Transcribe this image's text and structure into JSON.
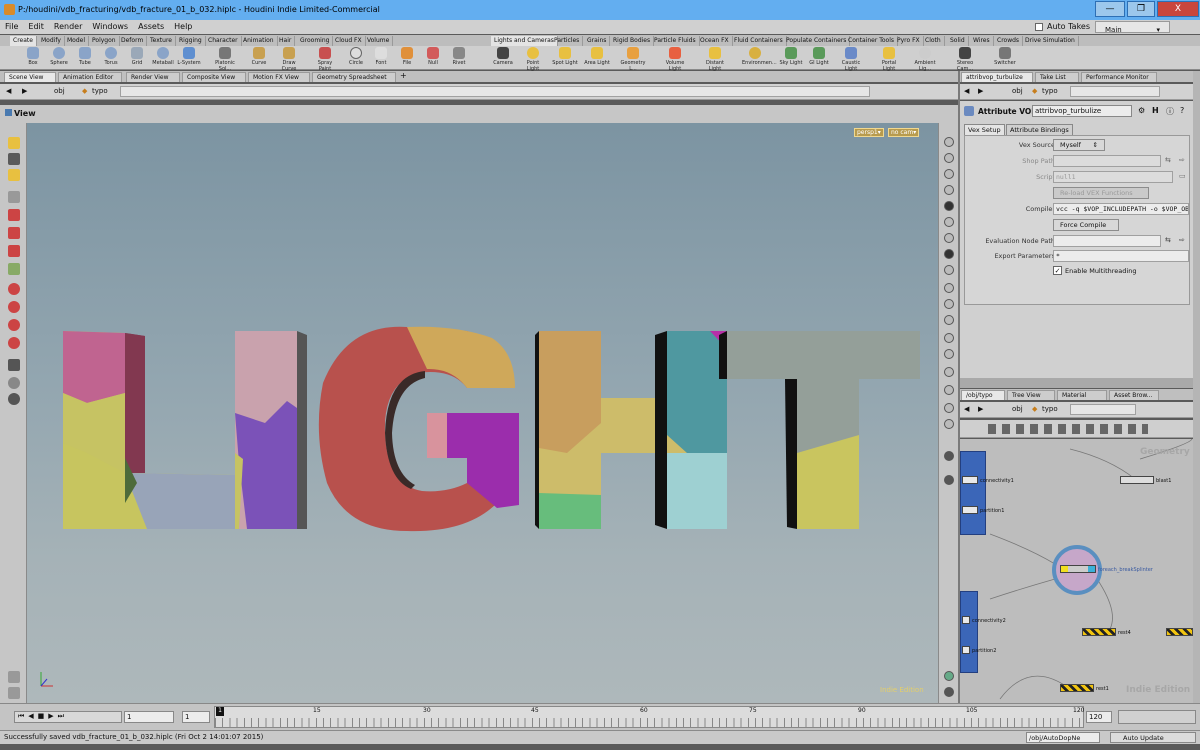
{
  "window": {
    "title": "P:/houdini/vdb_fracturing/vdb_fracture_01_b_032.hiplc - Houdini Indie Limited-Commercial",
    "minimize": "—",
    "maximize": "❐",
    "close": "X"
  },
  "menu": [
    "File",
    "Edit",
    "Render",
    "Windows",
    "Assets",
    "Help"
  ],
  "topright": {
    "auto_takes": "Auto Takes",
    "desktop": "Main"
  },
  "shelf_tabs_left": [
    "Create",
    "Modify",
    "Model",
    "Polygon",
    "Deform",
    "Texture",
    "Rigging",
    "Character",
    "Animation",
    "Hair",
    "Grooming",
    "Cloud FX",
    "Volume"
  ],
  "shelf_tabs_right": [
    "Lights and Cameras",
    "Particles",
    "Grains",
    "Rigid Bodies",
    "Particle Fluids",
    "Ocean FX",
    "Fluid Containers",
    "Populate Containers",
    "Container Tools",
    "Pyro FX",
    "Cloth",
    "Solid",
    "Wires",
    "Crowds",
    "Drive Simulation"
  ],
  "tools_left": [
    "Box",
    "Sphere",
    "Tube",
    "Torus",
    "Grid",
    "Metaball",
    "L-System",
    "Platonic Sol...",
    "Curve",
    "Draw Curve",
    "Spray Paint",
    "Circle",
    "Font",
    "File",
    "Null",
    "Rivet"
  ],
  "tools_right": [
    "Camera",
    "Point Light",
    "Spot Light",
    "Area Light",
    "Geometry L...",
    "Volume Light",
    "Distant Light",
    "Environmen...",
    "Sky Light",
    "GI Light",
    "Caustic Light",
    "Portal Light",
    "Ambient Lig...",
    "Stereo Cam...",
    "Switcher"
  ],
  "viewer_tabs": [
    "Scene View",
    "Animation Editor",
    "Render View",
    "Composite View",
    "Motion FX View",
    "Geometry Spreadsheet"
  ],
  "viewer_path": {
    "root": "obj",
    "node": "typo"
  },
  "view_label": "View",
  "viewport": {
    "camera": "persp1▾",
    "cam": "no cam▾",
    "watermark": "Indie Edition",
    "text": "LIGHT"
  },
  "timeline": {
    "start": "1",
    "current": "1",
    "end": "120",
    "ticks": [
      "1",
      "15",
      "30",
      "45",
      "60",
      "75",
      "90",
      "105",
      "120"
    ],
    "playhead": "1",
    "right_end": "120"
  },
  "status": {
    "message": "Successfully saved vdb_fracture_01_b_032.hiplc (Fri Oct  2 14:01:07 2015)",
    "path": "/obj/AutoDopNe",
    "update": "Auto Update"
  },
  "param_tabs": [
    "attribvop_turbulize",
    "Take List",
    "Performance Monitor"
  ],
  "param_path": {
    "root": "obj",
    "node": "typo"
  },
  "param_header": {
    "type": "Attribute VOP",
    "name": "attribvop_turbulize"
  },
  "param_subtabs": [
    "Vex Setup",
    "Attribute Bindings"
  ],
  "params": [
    {
      "label": "Vex Source",
      "value": "Myself",
      "kind": "menu"
    },
    {
      "label": "Shop Path",
      "value": "",
      "kind": "field-disabled"
    },
    {
      "label": "Script",
      "value": "null1",
      "kind": "field-disabled"
    },
    {
      "label": "",
      "value": "Re-load VEX Functions",
      "kind": "button-disabled"
    },
    {
      "label": "Compiler",
      "value": "vcc -q $VOP_INCLUDEPATH -o $VOP_OBJECTFILE",
      "kind": "field"
    },
    {
      "label": "",
      "value": "Force Compile",
      "kind": "button"
    },
    {
      "label": "Evaluation Node Path",
      "value": "",
      "kind": "field"
    },
    {
      "label": "Export Parameters",
      "value": "*",
      "kind": "field"
    },
    {
      "label": "",
      "value": "Enable Multithreading",
      "kind": "checkbox"
    }
  ],
  "net_tabs": [
    "/obj/typo",
    "Tree View",
    "Material Pal...",
    "Asset Brow..."
  ],
  "net_path": {
    "root": "obj",
    "node": "typo"
  },
  "net": {
    "context": "Geometry",
    "watermark": "Indie Edition",
    "nodes": [
      "connectivity1",
      "partition1",
      "blast1",
      "foreach_breakSplinter",
      "connectivity2",
      "partition2",
      "rest4",
      "rest1"
    ]
  }
}
